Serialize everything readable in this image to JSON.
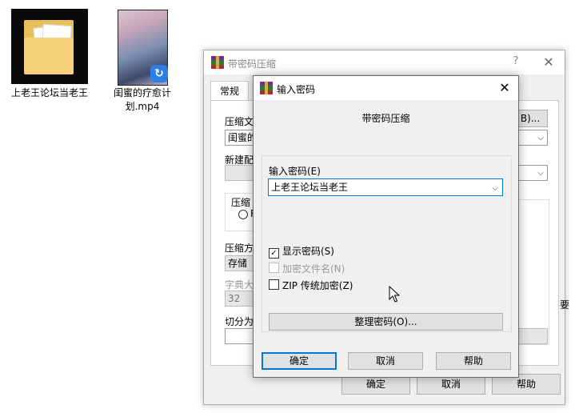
{
  "desktop": {
    "folder": {
      "label": "上老王论坛当老王"
    },
    "video": {
      "label": "闺蜜的疗愈计划.mp4"
    }
  },
  "bg_dialog": {
    "title": "带密码压缩",
    "help_glyph": "?",
    "close_glyph": "✕",
    "tab_general": "常规",
    "archive_name_label": "压缩文",
    "archive_name_value": "闺蜜的",
    "browse_button": "B)...",
    "new_profile_label": "新建配",
    "compress_group_label": "压缩",
    "radio_text": "R",
    "method_label": "压缩方",
    "method_value": "存储",
    "dict_label": "字典大",
    "dict_value": "32",
    "split_label": "切分为",
    "side_text": "要",
    "ok_button": "确定",
    "cancel_button": "取消",
    "help_button": "帮助"
  },
  "dialog": {
    "title": "输入密码",
    "close_glyph": "✕",
    "subtitle": "带密码压缩",
    "password_label": "输入密码(E)",
    "password_value": "上老王论坛当老王",
    "show_password": {
      "label": "显示密码(S)",
      "checked": true
    },
    "encrypt_filenames": {
      "label": "加密文件名(N)",
      "checked": false,
      "disabled": true
    },
    "zip_legacy": {
      "label": "ZIP 传统加密(Z)",
      "checked": false
    },
    "organize_button": "整理密码(O)...",
    "ok_button": "确定",
    "cancel_button": "取消",
    "help_button": "帮助"
  }
}
